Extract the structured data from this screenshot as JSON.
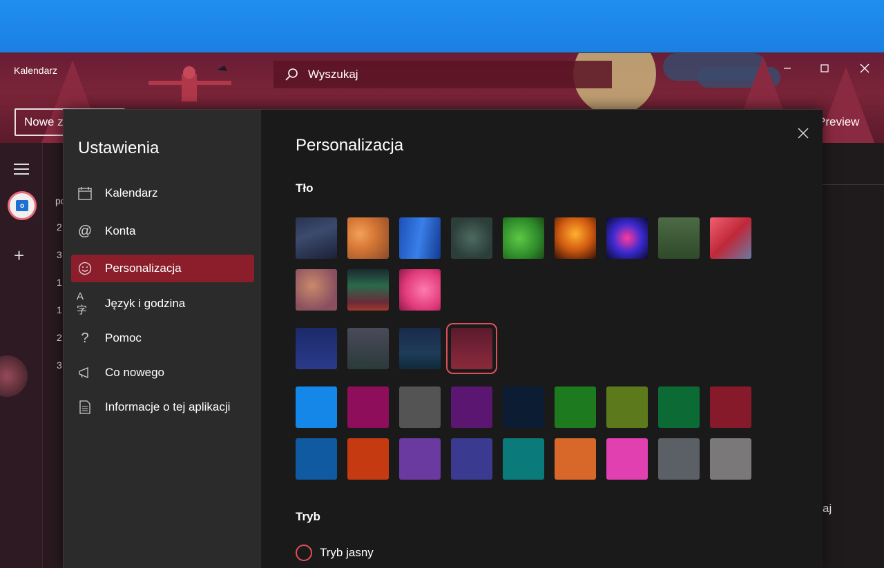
{
  "app": {
    "title": "Kalendarz",
    "search_placeholder": "Wyszukaj",
    "new_button": "Nowe z",
    "preview": "Preview",
    "right_partial": "aj",
    "calendar_partial": [
      "po",
      "2",
      "3",
      "1",
      "1",
      "2",
      "3"
    ]
  },
  "settings": {
    "title": "Ustawienia",
    "nav": [
      {
        "label": "Kalendarz",
        "icon": "calendar-icon"
      },
      {
        "label": "Konta",
        "icon": "at-icon"
      },
      {
        "label": "Personalizacja",
        "icon": "smiley-icon",
        "active": true
      },
      {
        "label": "Język i godzina",
        "icon": "language-icon"
      },
      {
        "label": "Pomoc",
        "icon": "question-icon"
      },
      {
        "label": "Co nowego",
        "icon": "megaphone-icon"
      },
      {
        "label": "Informacje o tej aplikacji",
        "icon": "document-icon"
      }
    ]
  },
  "personalization": {
    "title": "Personalizacja",
    "background_label": "Tło",
    "mode_label": "Tryb",
    "mode_option_light": "Tryb jasny",
    "selected_background": "scarecrow",
    "accent_color": "#e0505a",
    "solid_colors_row1": [
      "#1487e8",
      "#8e0e5c",
      "#545454",
      "#5a1670",
      "#0b1c33",
      "#1e7a1e",
      "#5c7a1c",
      "#0c6b35",
      "#861a2a"
    ],
    "solid_colors_row2": [
      "#0f5aa0",
      "#c53a10",
      "#6a3aa0",
      "#3a3a90",
      "#0b7a7a",
      "#d8682a",
      "#e040b0",
      "#5a6066",
      "#7a7878"
    ]
  }
}
